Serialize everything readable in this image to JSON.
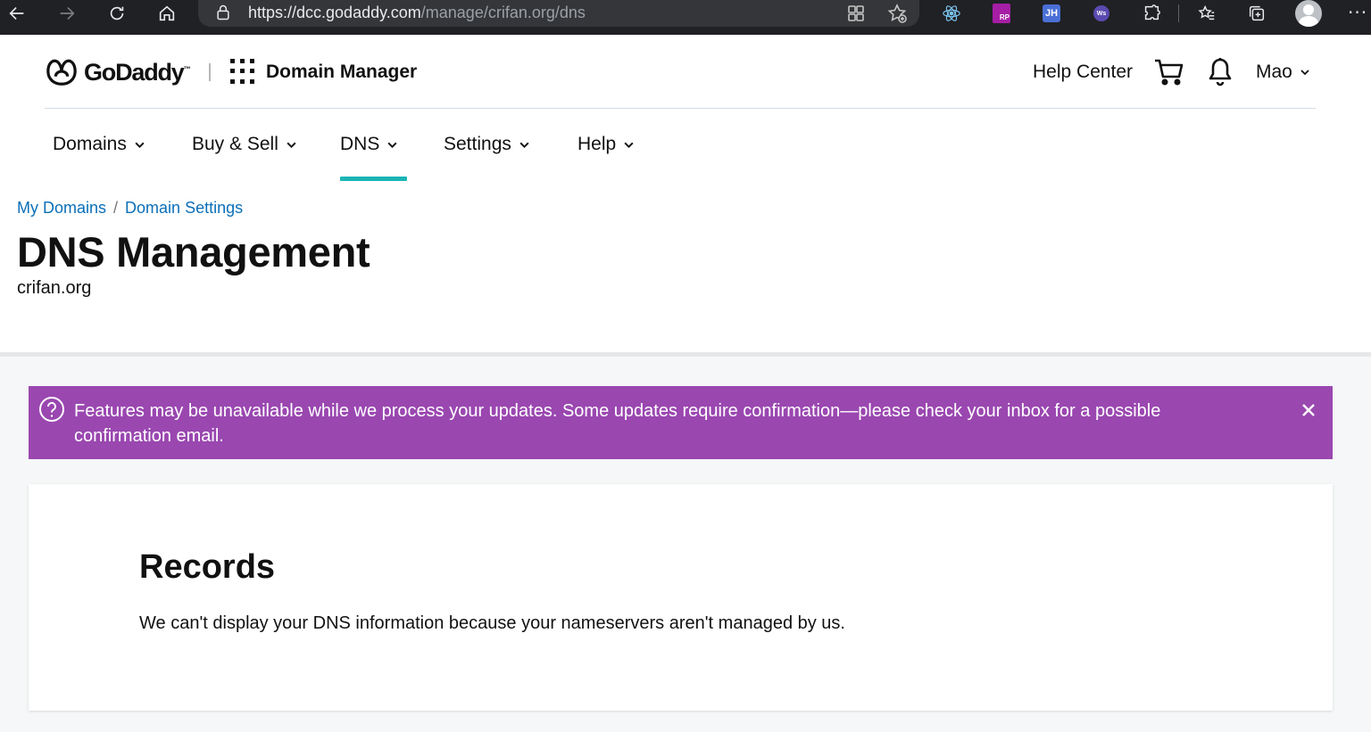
{
  "browser": {
    "url_host": "https://dcc.godaddy.com",
    "url_path": "/manage/crifan.org/dns",
    "icons": [
      "back-icon",
      "forward-icon",
      "reload-icon",
      "home-icon",
      "lock-icon",
      "apps-icon",
      "add-favorite-icon",
      "react-devtools-icon",
      "rp-extension-icon",
      "jh-extension-icon",
      "ws-extension-icon",
      "extensions-icon",
      "favorites-icon",
      "collections-icon",
      "profile-icon",
      "more-icon"
    ],
    "more": "···"
  },
  "header": {
    "brand": "GoDaddy",
    "brand_mark": "™",
    "app_name": "Domain Manager",
    "help_center": "Help Center",
    "user": "Mao"
  },
  "nav": {
    "items": [
      {
        "label": "Domains"
      },
      {
        "label": "Buy & Sell"
      },
      {
        "label": "DNS",
        "active": true
      },
      {
        "label": "Settings"
      },
      {
        "label": "Help"
      }
    ],
    "active_color": "#1bb5b5"
  },
  "breadcrumb": {
    "items": [
      "My Domains",
      "Domain Settings"
    ],
    "separator": "/"
  },
  "page": {
    "title": "DNS Management",
    "domain": "crifan.org"
  },
  "alert": {
    "text": "Features may be unavailable while we process your updates. Some updates require confirmation—please check your inbox for a possible confirmation email.",
    "color": "#9a47b0"
  },
  "records": {
    "title": "Records",
    "message": "We can't display your DNS information because your nameservers aren't managed by us."
  }
}
